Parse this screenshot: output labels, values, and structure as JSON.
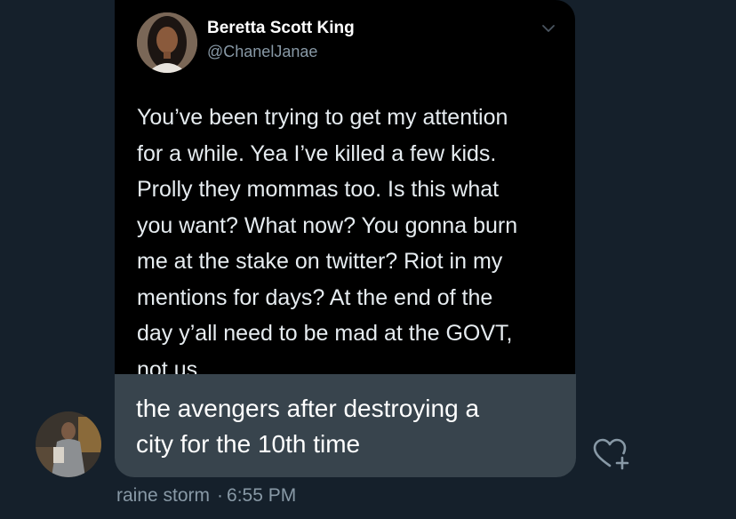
{
  "quoted_tweet": {
    "author_name": "Beretta Scott King",
    "author_handle": "@ChanelJanae",
    "text_lines": [
      "You’ve been trying to get my attention",
      "for a while. Yea I’ve killed a few kids.",
      "Prolly they mommas too. Is this what",
      "you want? What now? You gonna burn",
      "me at the stake on twitter? Riot in my",
      "mentions for days? At the end of the",
      "day y’all need to be mad at the GOVT,",
      "not us."
    ],
    "menu_icon": "chevron-down-icon",
    "avatar_icon": "profile-photo"
  },
  "message": {
    "lines": [
      "the avengers after destroying a",
      "city for the 10th time"
    ],
    "sender_name": "raine storm",
    "separator": "·",
    "time": "6:55 PM",
    "react_icon": "heart-plus-icon"
  },
  "colors": {
    "background": "#15202b",
    "bubble": "#38444d",
    "card": "#000000",
    "secondary_text": "#8899a6"
  }
}
